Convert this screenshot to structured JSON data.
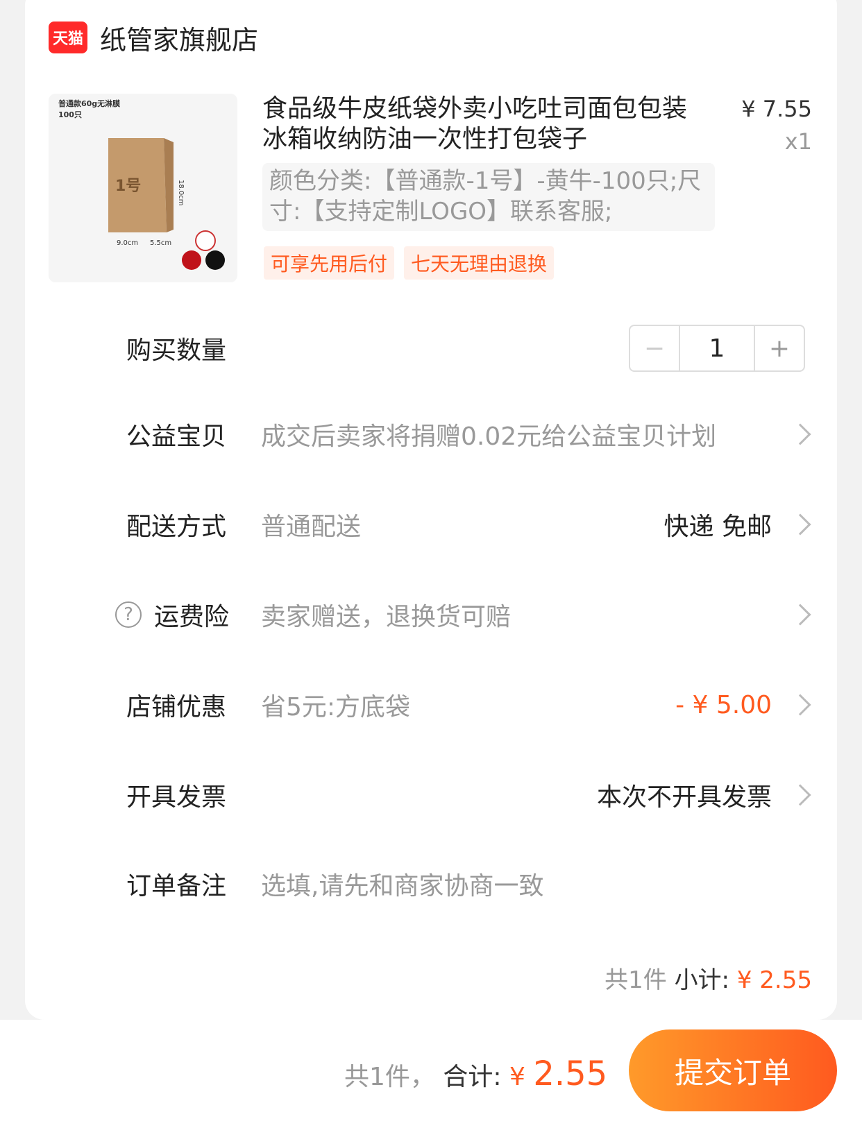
{
  "shop": {
    "logo_text": "天猫",
    "name": "纸管家旗舰店"
  },
  "product": {
    "title": "食品级牛皮纸袋外卖小吃吐司面包包装冰箱收纳防油一次性打包袋子",
    "price": "¥ 7.55",
    "qty": "x1",
    "sku": "颜色分类:【普通款-1号】-黄牛-100只;尺寸:【支持定制LOGO】联系客服;",
    "image": {
      "badge_text": "普通款60g无淋膜",
      "count_text": "100只",
      "bag_number": "1号",
      "dim_h": "18.0cm",
      "dim_w": "9.0cm",
      "dim_d": "5.5cm"
    },
    "tags": [
      "可享先用后付",
      "七天无理由退换"
    ]
  },
  "quantity": {
    "label": "购买数量",
    "value": "1",
    "minus": "−",
    "plus": "+"
  },
  "charity": {
    "label": "公益宝贝",
    "text": "成交后卖家将捐赠0.02元给公益宝贝计划"
  },
  "delivery": {
    "label": "配送方式",
    "method": "普通配送",
    "value": "快递 免邮"
  },
  "insurance": {
    "label": "运费险",
    "text": "卖家赠送，退换货可赔",
    "icon": "?"
  },
  "discount": {
    "label": "店铺优惠",
    "text": "省5元:方底袋",
    "value": "- ¥ 5.00"
  },
  "invoice": {
    "label": "开具发票",
    "value": "本次不开具发票"
  },
  "note": {
    "label": "订单备注",
    "placeholder": "选填,请先和商家协商一致"
  },
  "subtotal": {
    "count": "共1件",
    "label": "小计:",
    "currency": "¥",
    "amount": "2.55"
  },
  "footer": {
    "count": "共1件，",
    "label": "合计:",
    "currency": "¥",
    "amount": "2.55",
    "submit": "提交订单"
  },
  "colors": {
    "accent": "#ff5a1f",
    "tmall_red": "#ff2a2a"
  }
}
